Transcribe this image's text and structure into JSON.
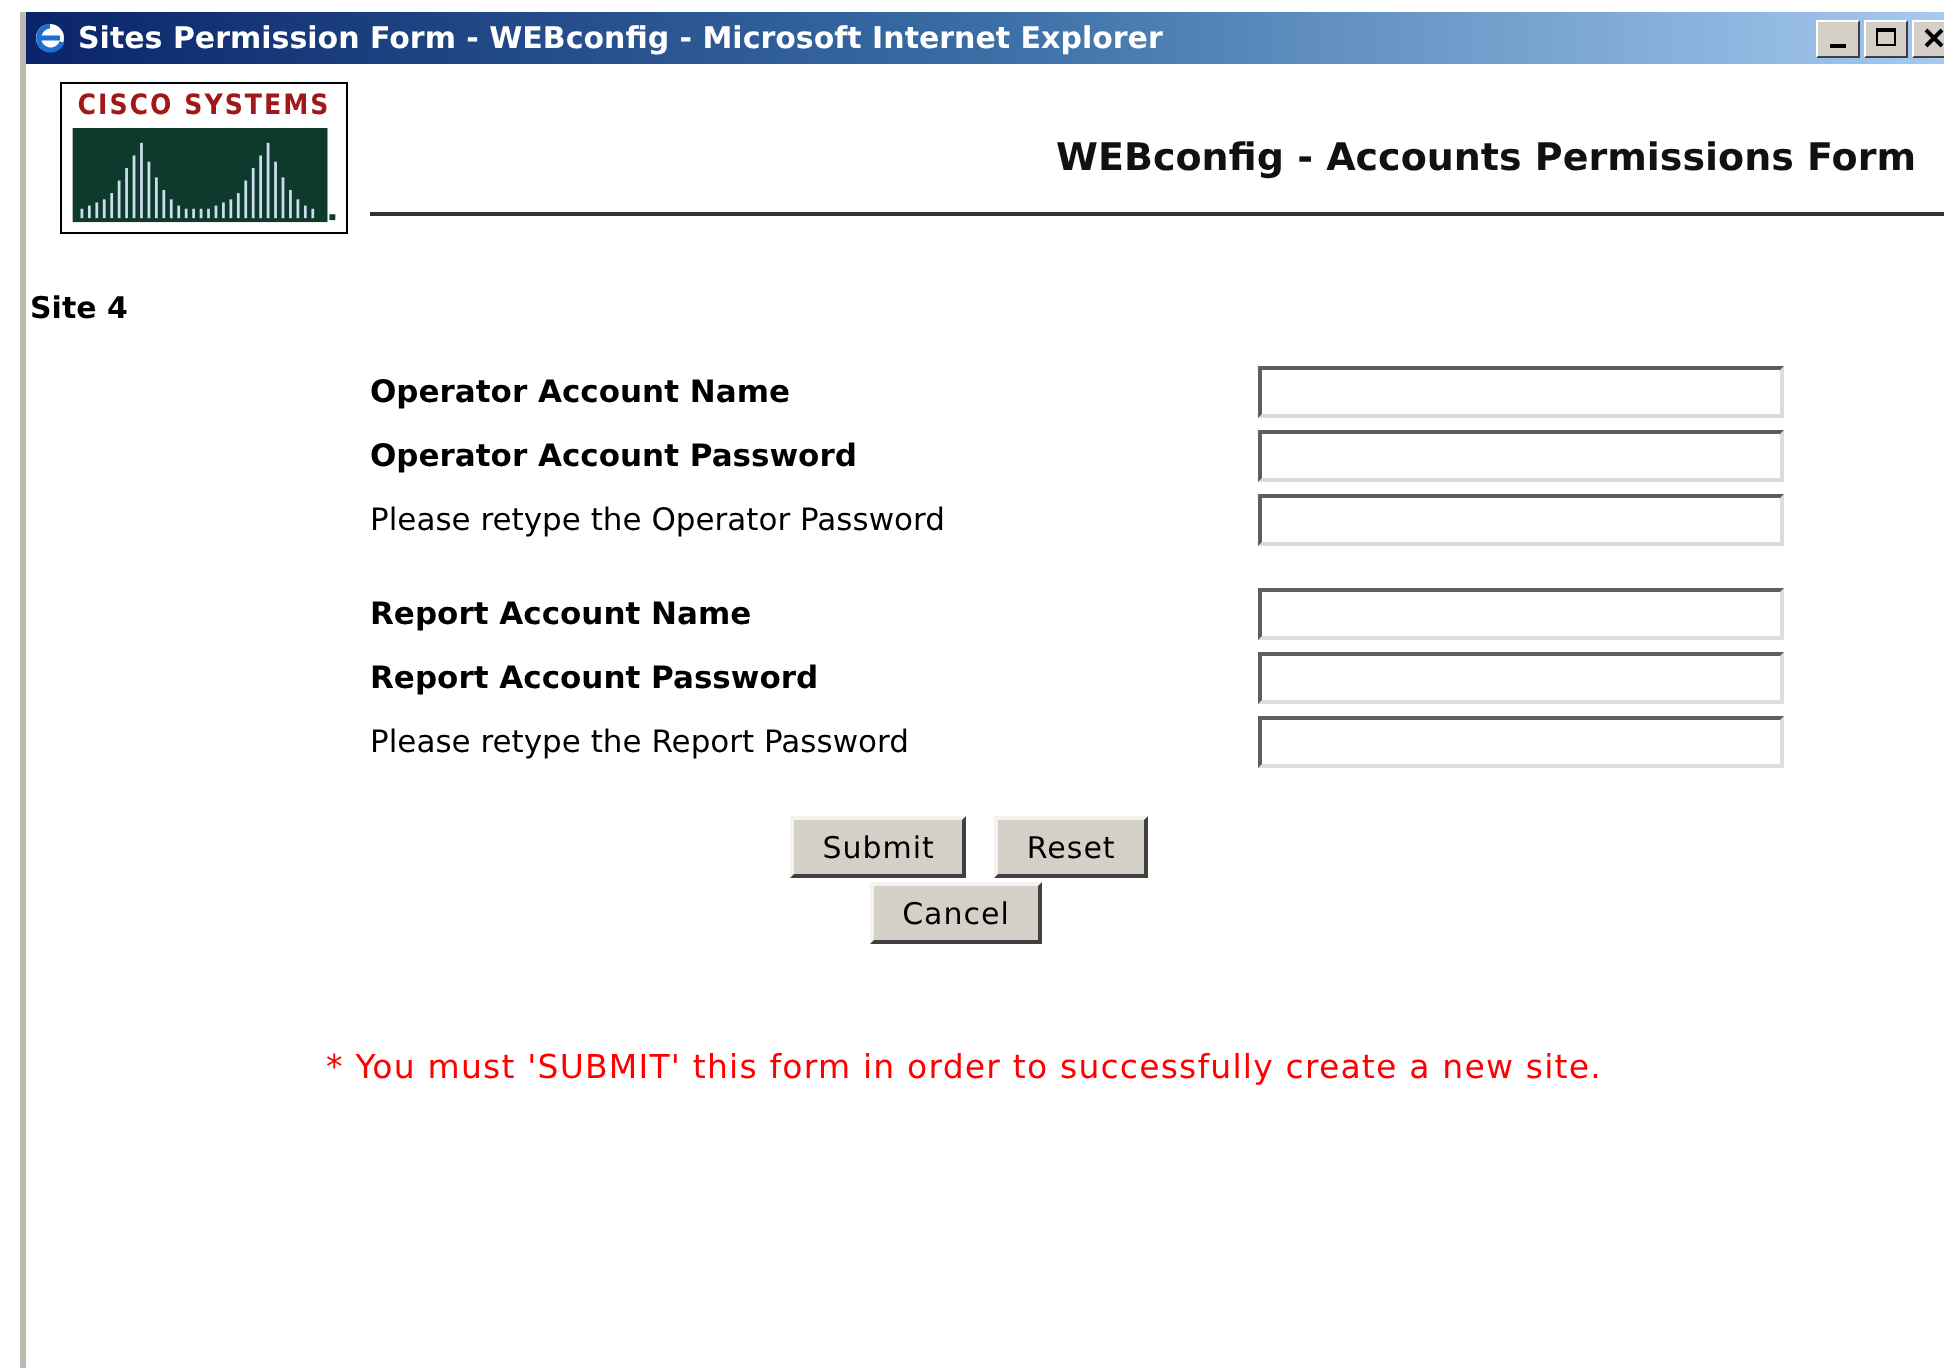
{
  "window": {
    "title": "Sites Permission Form - WEBconfig - Microsoft Internet Explorer"
  },
  "header": {
    "logo_text": "CISCO SYSTEMS",
    "title": "WEBconfig - Accounts Permissions Form"
  },
  "site": "Site 4",
  "field_groups": [
    {
      "fields": [
        {
          "label": "Operator Account Name",
          "kind": "bold"
        },
        {
          "label": "Operator Account Password",
          "kind": "bold"
        },
        {
          "label": "Please retype the Operator Password",
          "kind": "plain"
        }
      ]
    },
    {
      "fields": [
        {
          "label": "Report Account Name",
          "kind": "bold"
        },
        {
          "label": "Report Account Password",
          "kind": "bold"
        },
        {
          "label": "Please retype the Report Password",
          "kind": "plain"
        }
      ]
    }
  ],
  "buttons": [
    [
      "Submit",
      "Reset"
    ],
    [
      "Cancel"
    ]
  ],
  "note": "* You must 'SUBMIT' this form in order to successfully create a new site."
}
